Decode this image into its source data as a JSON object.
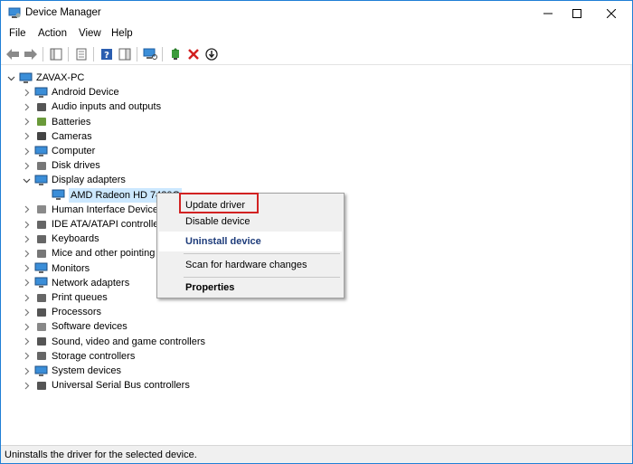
{
  "window": {
    "title": "Device Manager",
    "icon": "device-manager-icon"
  },
  "menu": [
    "File",
    "Action",
    "View",
    "Help"
  ],
  "toolbar": {
    "icons": [
      "back-arrow-icon",
      "forward-arrow-icon",
      "show-hide-console-tree-icon",
      "properties-icon",
      "help-icon",
      "action-pane-icon",
      "scan-hardware-icon",
      "add-driver-icon",
      "uninstall-x-icon",
      "update-driver-down-icon"
    ]
  },
  "tree": {
    "root": "ZAVAX-PC",
    "items": [
      {
        "label": "Android Device",
        "icon": "android-device-icon"
      },
      {
        "label": "Audio inputs and outputs",
        "icon": "speaker-icon"
      },
      {
        "label": "Batteries",
        "icon": "battery-icon"
      },
      {
        "label": "Cameras",
        "icon": "camera-icon"
      },
      {
        "label": "Computer",
        "icon": "computer-icon"
      },
      {
        "label": "Disk drives",
        "icon": "disk-drive-icon"
      },
      {
        "label": "Display adapters",
        "icon": "display-adapter-icon",
        "expanded": true
      },
      {
        "label": "AMD Radeon HD 7420G",
        "icon": "monitor-icon",
        "child": true,
        "selected": true
      },
      {
        "label": "Human Interface Devices",
        "icon": "hid-icon"
      },
      {
        "label": "IDE ATA/ATAPI controllers",
        "icon": "ide-controller-icon"
      },
      {
        "label": "Keyboards",
        "icon": "keyboard-icon"
      },
      {
        "label": "Mice and other pointing devices",
        "icon": "mouse-icon"
      },
      {
        "label": "Monitors",
        "icon": "monitor-icon"
      },
      {
        "label": "Network adapters",
        "icon": "network-adapter-icon"
      },
      {
        "label": "Print queues",
        "icon": "printer-icon"
      },
      {
        "label": "Processors",
        "icon": "processor-icon"
      },
      {
        "label": "Software devices",
        "icon": "software-device-icon"
      },
      {
        "label": "Sound, video and game controllers",
        "icon": "sound-icon"
      },
      {
        "label": "Storage controllers",
        "icon": "storage-controller-icon"
      },
      {
        "label": "System devices",
        "icon": "system-device-icon"
      },
      {
        "label": "Universal Serial Bus controllers",
        "icon": "usb-icon"
      }
    ]
  },
  "context_menu": {
    "items": [
      "Update driver",
      "Disable device",
      "Uninstall device",
      "Scan for hardware changes",
      "Properties"
    ]
  },
  "status": {
    "text": "Uninstalls the driver for the selected device."
  },
  "colors": {
    "accent": "#1f7fd6",
    "selection": "#cce8ff",
    "highlight_border": "#d22222"
  }
}
